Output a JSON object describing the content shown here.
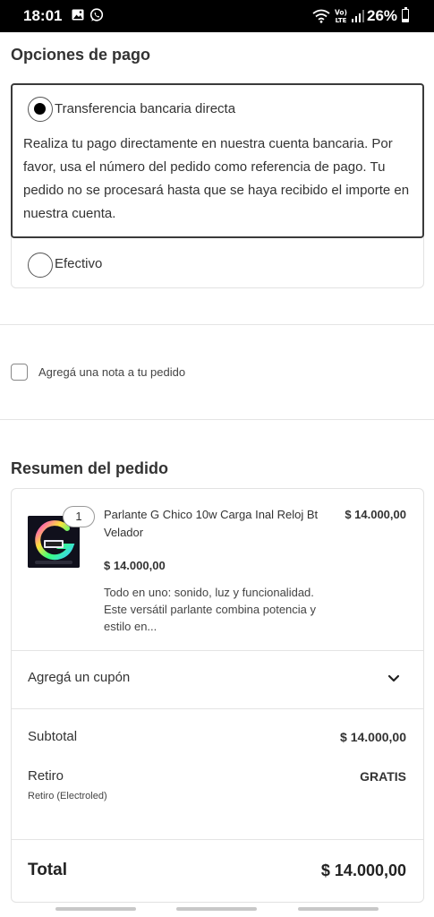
{
  "status_bar": {
    "time": "18:01",
    "battery_percent": "26%",
    "battery_level": 0.26,
    "icons": [
      "gallery-icon",
      "whatsapp-icon",
      "wifi-icon",
      "volte-icon",
      "signal-icon",
      "battery-icon"
    ]
  },
  "payment": {
    "title": "Opciones de pago",
    "options": [
      {
        "label": "Transferencia bancaria directa",
        "selected": true,
        "description": "Realiza tu pago directamente en nuestra cuenta bancaria. Por favor, usa el número del pedido como referencia de pago. Tu pedido no se procesará hasta que se haya recibido el importe en nuestra cuenta."
      },
      {
        "label": "Efectivo",
        "selected": false
      }
    ]
  },
  "order_note": {
    "label": "Agregá una nota a tu pedido",
    "checked": false
  },
  "summary": {
    "title": "Resumen del pedido",
    "product": {
      "quantity": "1",
      "name": "Parlante G Chico 10w Carga Inal Reloj Bt Velador",
      "line_total": "$ 14.000,00",
      "unit_price": "$ 14.000,00",
      "description": "Todo en uno: sonido, luz y funcionalidad. Este versátil parlante combina potencia y estilo en..."
    },
    "coupon_label": "Agregá un cupón",
    "subtotal_label": "Subtotal",
    "subtotal_value": "$ 14.000,00",
    "pickup_label": "Retiro",
    "pickup_value": "GRATIS",
    "pickup_detail": "Retiro (Electroled)",
    "total_label": "Total",
    "total_value": "$ 14.000,00"
  },
  "colors": {
    "selected_border": "#3a3a3a",
    "card_border": "#e2e2e2",
    "text": "#333333"
  }
}
